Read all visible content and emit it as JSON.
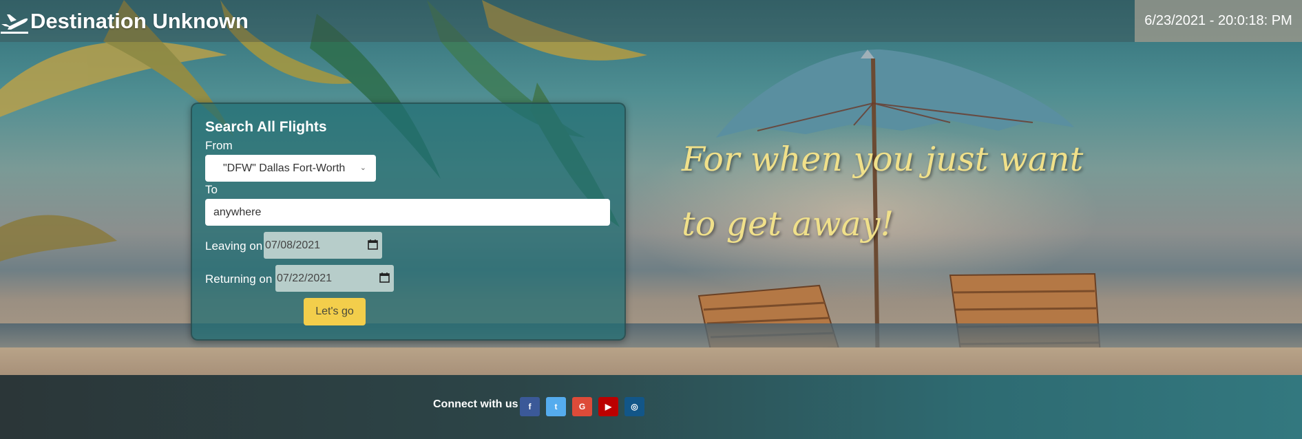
{
  "header": {
    "brand_title": "Destination Unknown",
    "brand_icon": "plane-departure-icon",
    "clock": "6/23/2021 - 20:0:18: PM"
  },
  "search": {
    "title": "Search All Flights",
    "from_label": "From",
    "from_value": "\"DFW\" Dallas Fort-Worth",
    "to_label": "To",
    "to_value": "anywhere",
    "leaving_label": "Leaving on",
    "leaving_value": "07/08/2021",
    "returning_label": "Returning on",
    "returning_value": "07/22/2021",
    "submit_label": "Let's go"
  },
  "tagline": {
    "line1": "For when you just want",
    "line2": "to get away!"
  },
  "footer": {
    "connect_label": "Connect with us",
    "social": [
      {
        "name": "facebook-icon",
        "glyph": "f",
        "color": "#3b5998"
      },
      {
        "name": "twitter-icon",
        "glyph": "t",
        "color": "#55acee"
      },
      {
        "name": "google-icon",
        "glyph": "G",
        "color": "#dd4b39"
      },
      {
        "name": "youtube-icon",
        "glyph": "▶",
        "color": "#bb0000"
      },
      {
        "name": "instagram-icon",
        "glyph": "◎",
        "color": "#125688"
      }
    ]
  },
  "colors": {
    "accent_button": "#f3ce4b",
    "tagline": "#f0e08a",
    "card": "#1e6e73"
  }
}
